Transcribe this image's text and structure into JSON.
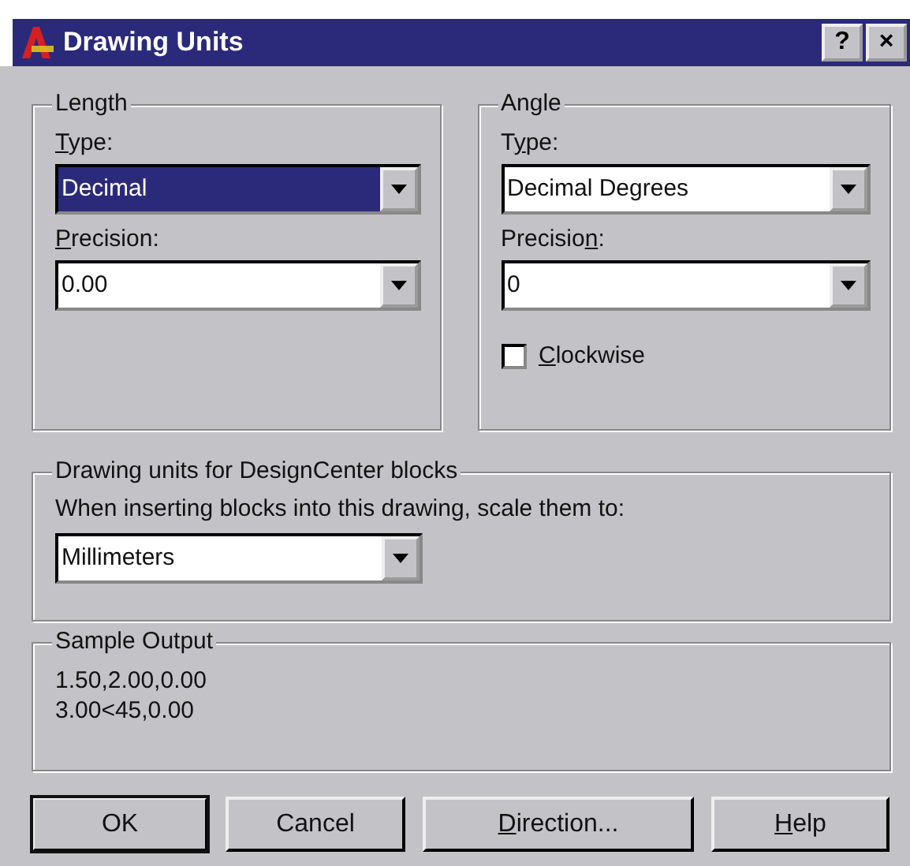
{
  "window": {
    "title": "Drawing Units",
    "title_buttons": [
      "?",
      "×"
    ]
  },
  "length": {
    "title": "Length",
    "type": {
      "label": {
        "key": "T",
        "after": "ype:"
      },
      "value": "Decimal",
      "selected": true
    },
    "precision": {
      "label": {
        "key": "P",
        "after": "recision:"
      },
      "value": "0.00",
      "selected": false
    }
  },
  "angle": {
    "title": "Angle",
    "type": {
      "label": {
        "before": "T",
        "key": "y",
        "after": "pe:"
      },
      "value": "Decimal Degrees",
      "selected": false
    },
    "precision": {
      "label": {
        "before": "Precisio",
        "key": "n",
        "after": ":"
      },
      "value": "0",
      "selected": false
    },
    "clockwise": {
      "label": {
        "key": "C",
        "after": "lockwise"
      },
      "checked": false
    }
  },
  "designcenter": {
    "title": "Drawing units for DesignCenter blocks",
    "prompt": "When inserting blocks into this drawing, scale them to:",
    "value": "Millimeters"
  },
  "sample_output": {
    "title": "Sample Output",
    "lines": [
      "1.50,2.00,0.00",
      "3.00<45,0.00"
    ]
  },
  "buttons": [
    {
      "label": {
        "after": "OK"
      },
      "default": true
    },
    {
      "label": {
        "after": "Cancel"
      },
      "default": false
    },
    {
      "label": {
        "key": "D",
        "after": "irection..."
      },
      "default": false
    },
    {
      "label": {
        "key": "H",
        "after": "elp"
      },
      "default": false
    }
  ]
}
